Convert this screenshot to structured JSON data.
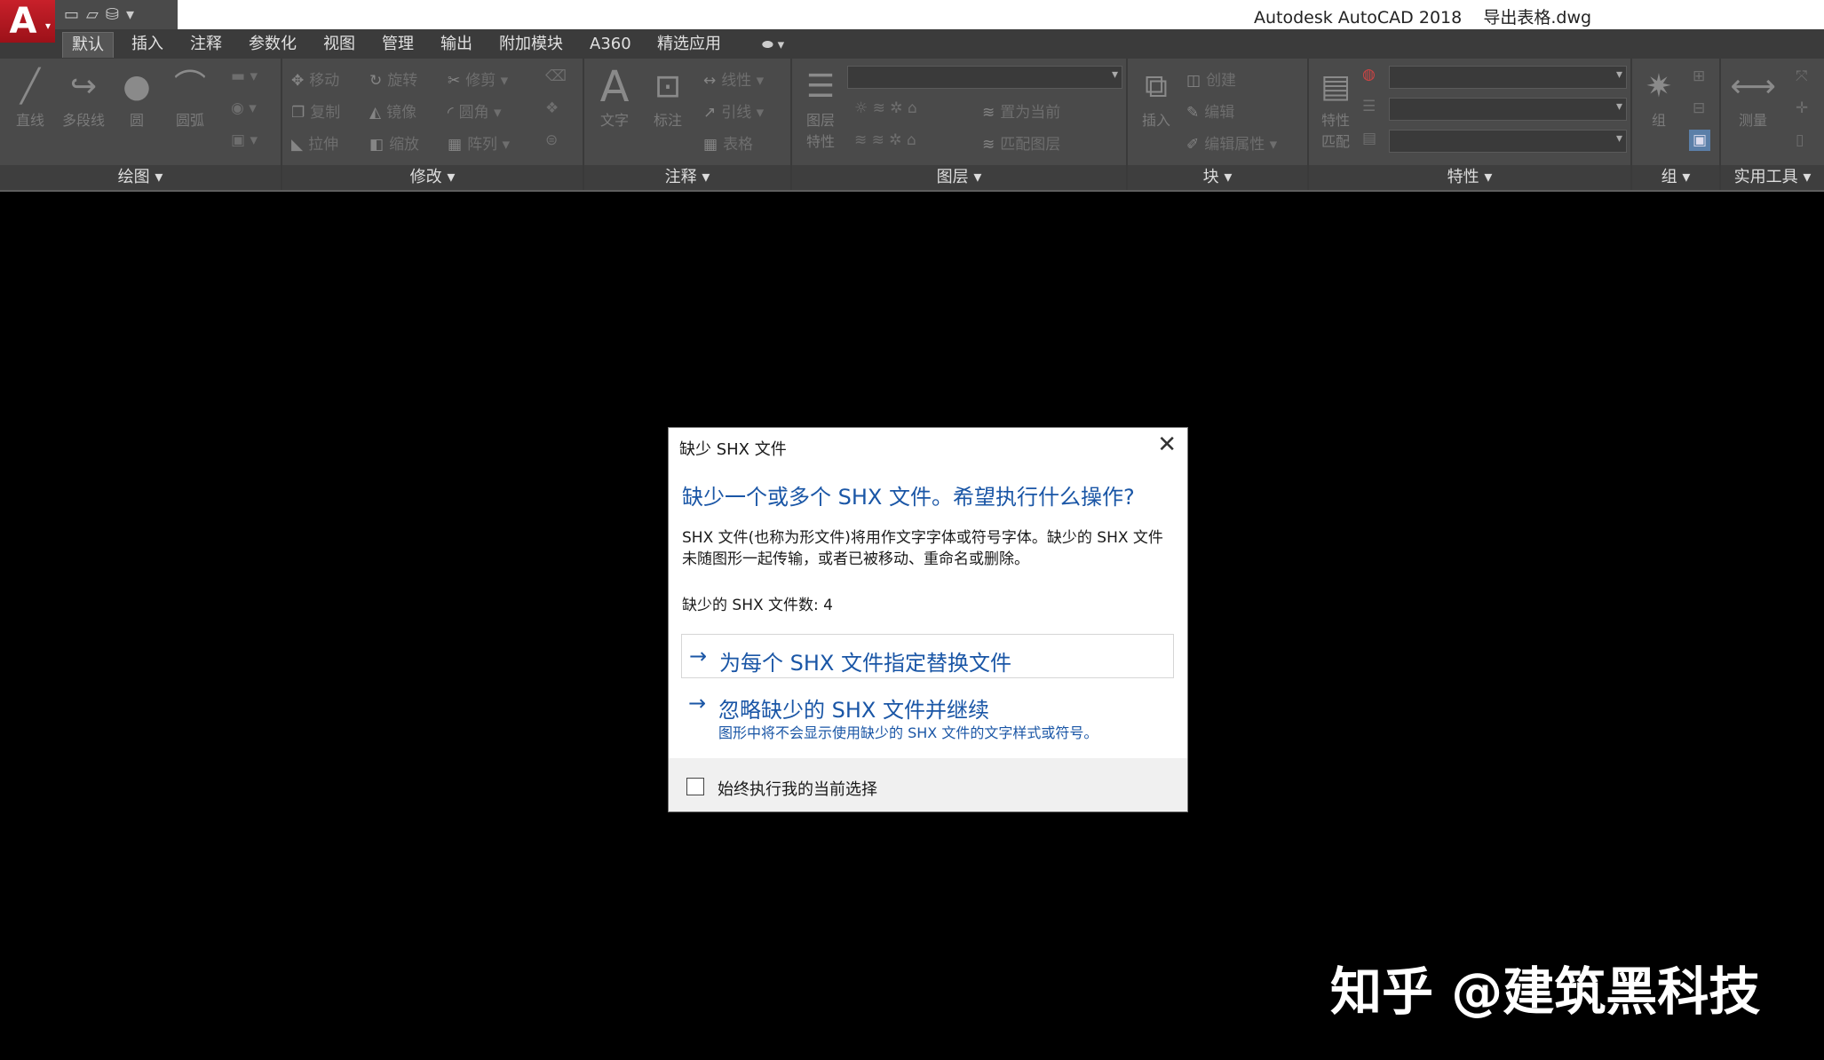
{
  "title_bar": {
    "app_title": "Autodesk AutoCAD 2018    导出表格.dwg",
    "app_logo": "A"
  },
  "quick_access": [
    "new-icon",
    "open-icon",
    "save-icon",
    "dropdown-icon"
  ],
  "tabs": [
    "默认",
    "插入",
    "注释",
    "参数化",
    "视图",
    "管理",
    "输出",
    "附加模块",
    "A360",
    "精选应用"
  ],
  "ribbon": {
    "draw": {
      "title": "绘图",
      "line": "直线",
      "polyline": "多段线",
      "circle": "圆",
      "arc": "圆弧"
    },
    "modify": {
      "title": "修改",
      "move": "移动",
      "rotate": "旋转",
      "trim": "修剪",
      "copy": "复制",
      "mirror": "镜像",
      "fillet": "圆角",
      "stretch": "拉伸",
      "scale": "缩放",
      "array": "阵列"
    },
    "annotation": {
      "title": "注释",
      "text": "文字",
      "dimension": "标注",
      "linear": "线性",
      "leader": "引线",
      "table": "表格"
    },
    "layers": {
      "title": "图层",
      "layer_props_1": "图层",
      "layer_props_2": "特性",
      "set_current": "置为当前",
      "match_layer": "匹配图层"
    },
    "block": {
      "title": "块",
      "insert": "插入",
      "create": "创建",
      "edit": "编辑",
      "edit_attr": "编辑属性"
    },
    "properties": {
      "title": "特性",
      "match_1": "特性",
      "match_2": "匹配"
    },
    "groups": {
      "title": "组",
      "group": "组"
    },
    "utilities": {
      "title": "实用工具",
      "measure": "测量"
    }
  },
  "dialog": {
    "title": "缺少 SHX 文件",
    "heading": "缺少一个或多个 SHX 文件。希望执行什么操作?",
    "description": "SHX 文件(也称为形文件)将用作文字字体或符号字体。缺少的 SHX 文件未随图形一起传输，或者已被移动、重命名或删除。",
    "count": "缺少的 SHX 文件数: 4",
    "option1": "为每个 SHX 文件指定替换文件",
    "option2": "忽略缺少的 SHX 文件并继续",
    "option2_sub": "图形中将不会显示使用缺少的 SHX 文件的文字样式或符号。",
    "checkbox_label": "始终执行我的当前选择",
    "checkbox_checked": false
  },
  "watermark": "知乎 @建筑黑科技"
}
